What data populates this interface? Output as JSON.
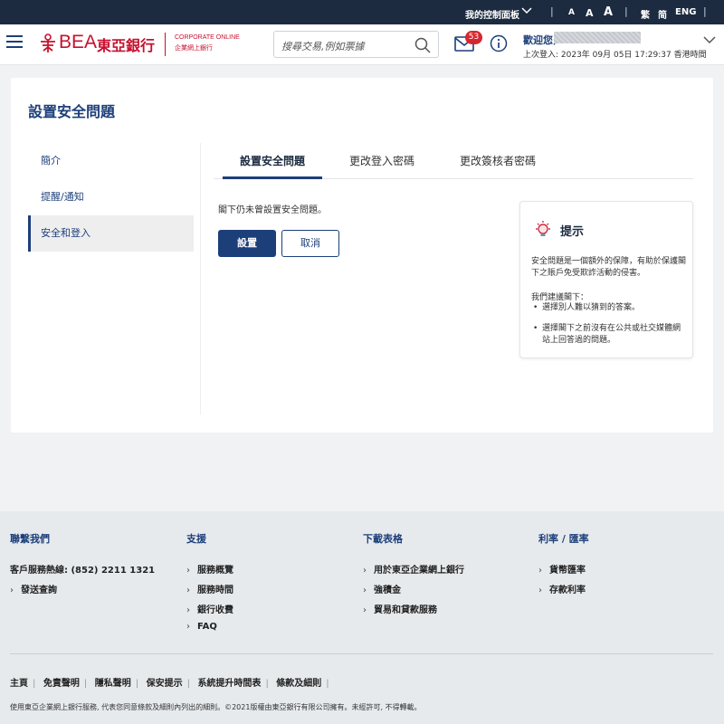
{
  "topbar": {
    "dashboard": "我的控制面板",
    "font_sizes": [
      "A",
      "A",
      "A"
    ],
    "lang_trad": "繁",
    "lang_simp": "简",
    "lang_eng": "ENG"
  },
  "header": {
    "logo_bea": "BEA",
    "logo_cn": "東亞銀行",
    "corp_en": "CORPORATE ONLINE",
    "corp_cn": "企業網上銀行",
    "search_placeholder": "搜尋交易,例如票據",
    "mail_count": "53",
    "welcome": "歡迎您,",
    "last_login": "上次登入: 2023年 09月 05日 17:29:37 香港時間"
  },
  "page": {
    "title": "設置安全問題",
    "sidebar": [
      "簡介",
      "提醒/通知",
      "安全和登入"
    ],
    "tabs": [
      "設置安全問題",
      "更改登入密碼",
      "更改簽核者密碼"
    ],
    "not_set_msg": "閣下仍未曾設置安全問題。",
    "set_button": "設置",
    "cancel_button": "取消",
    "tip": {
      "title": "提示",
      "p1": "安全問題是一個額外的保障，有助於保護閣下之賬戶免受欺詐活動的侵害。",
      "p2": "我們建議閣下：",
      "items": [
        "選擇別人難以猜到的答案。",
        "選擇閣下之前沒有在公共或社交媒體網站上回答過的問題。"
      ]
    }
  },
  "footer": {
    "contact": {
      "title": "聯繫我們",
      "hotline": "客戶服務熱線: (852) 2211 1321",
      "items": [
        "發送查詢"
      ]
    },
    "support": {
      "title": "支援",
      "items": [
        "服務概覽",
        "服務時間",
        "銀行收費",
        "FAQ"
      ]
    },
    "forms": {
      "title": "下載表格",
      "items": [
        "用於東亞企業網上銀行",
        "強積金",
        "貿易和貸款服務"
      ]
    },
    "rates": {
      "title": "利率 / 匯率",
      "items": [
        "貨幣匯率",
        "存款利率"
      ]
    },
    "links": [
      "主頁",
      "免責聲明",
      "隱私聲明",
      "保安提示",
      "系統提升時間表",
      "條款及細則"
    ],
    "copyright": "使用東亞企業網上銀行服務, 代表您同意條款及細則內列出的細則。©2021版權由東亞銀行有限公司擁有。未經許可, 不得轉載。"
  },
  "colors": {
    "navy": "#1c3f7a",
    "brand_red": "#c8102e",
    "topbar": "#1c2b3f"
  }
}
